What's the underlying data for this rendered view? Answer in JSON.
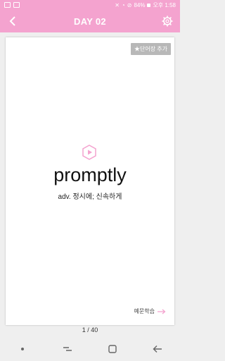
{
  "status_bar": {
    "icons_left": [
      "image-icon",
      "square-icon"
    ],
    "icons_right": [
      "mute-icon",
      "wifi-icon",
      "no-signal-icon"
    ],
    "battery": "84%",
    "time": "오후 1:58"
  },
  "header": {
    "title": "DAY 02",
    "back_icon": "chevron-left-icon",
    "settings_icon": "gear-icon"
  },
  "card": {
    "add_word_label": "★단어장 추가",
    "word": "promptly",
    "meaning": "adv. 정시에; 신속하게",
    "play_icon": "play-icon",
    "example_label": "예문학습",
    "example_icon": "arrow-right-icon"
  },
  "pagination": {
    "text": "1 / 40"
  },
  "nav_bar": {
    "icons": [
      "dot-icon",
      "recent-apps-icon",
      "home-icon",
      "back-icon"
    ]
  },
  "colors": {
    "accent": "#f4a3cf",
    "background": "#efefef",
    "card": "#ffffff",
    "chip": "#b8b8b8"
  }
}
